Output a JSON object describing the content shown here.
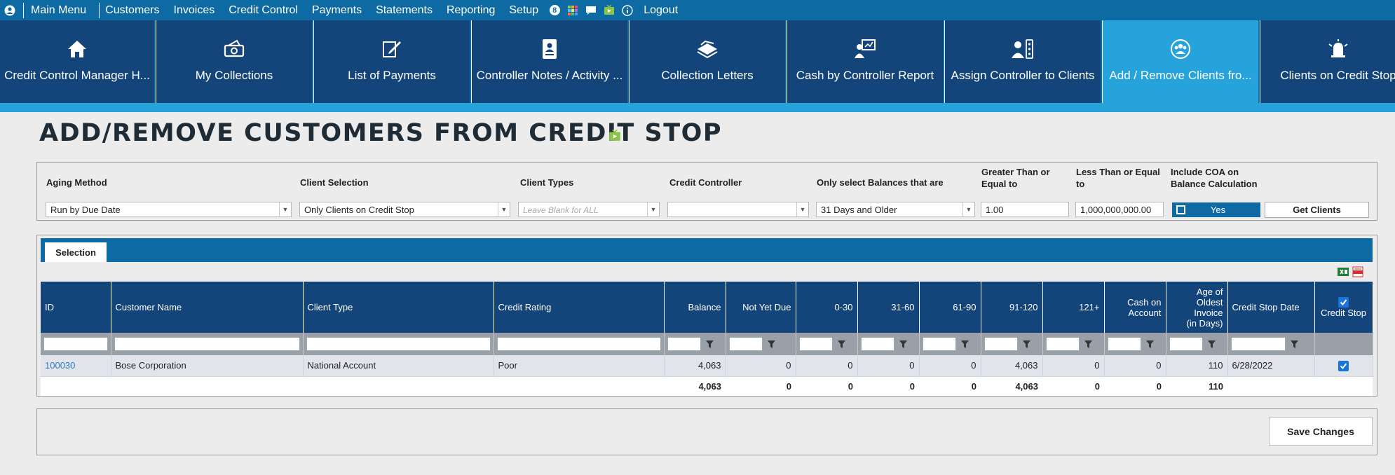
{
  "menu": {
    "items": [
      "Main Menu",
      "Customers",
      "Invoices",
      "Credit Control",
      "Payments",
      "Statements",
      "Reporting",
      "Setup"
    ],
    "badge": "8",
    "logout": "Logout"
  },
  "tiles": [
    {
      "label": "Credit Control Manager H...",
      "icon": "home-icon"
    },
    {
      "label": "My Collections",
      "icon": "money-icon"
    },
    {
      "label": "List of Payments",
      "icon": "pen-icon"
    },
    {
      "label": "Controller Notes / Activity ...",
      "icon": "notebook-icon"
    },
    {
      "label": "Collection Letters",
      "icon": "letters-icon"
    },
    {
      "label": "Cash by Controller Report",
      "icon": "presenter-icon"
    },
    {
      "label": "Assign Controller to Clients",
      "icon": "assign-icon"
    },
    {
      "label": "Add / Remove Clients fro...",
      "icon": "group-icon",
      "active": true
    },
    {
      "label": "Clients on Credit Stop",
      "icon": "alarm-icon"
    }
  ],
  "page": {
    "title": "ADD/REMOVE CUSTOMERS FROM CREDIT STOP"
  },
  "filters": {
    "aging_method": {
      "label": "Aging Method",
      "value": "Run by Due Date"
    },
    "client_selection": {
      "label": "Client Selection",
      "value": "Only Clients on Credit Stop"
    },
    "client_types": {
      "label": "Client Types",
      "placeholder": "Leave Blank for ALL"
    },
    "credit_controller": {
      "label": "Credit Controller",
      "value": ""
    },
    "balances": {
      "label": "Only select Balances that are",
      "value": "31 Days and Older"
    },
    "greater_than": {
      "label_1": "Greater Than or",
      "label_2": "Equal to",
      "value": "1.00"
    },
    "less_than": {
      "label_1": "Less Than or Equal",
      "label_2": "to",
      "value": "1,000,000,000.00"
    },
    "include_coa": {
      "label_1": "Include COA on",
      "label_2": "Balance Calculation",
      "value": "Yes"
    },
    "get_clients": "Get Clients"
  },
  "grid": {
    "tab": "Selection",
    "headers": {
      "id": "ID",
      "name": "Customer Name",
      "type": "Client Type",
      "rating": "Credit Rating",
      "balance": "Balance",
      "nyd": "Not Yet Due",
      "b0_30": "0-30",
      "b31_60": "31-60",
      "b61_90": "61-90",
      "b91_120": "91-120",
      "b121": "121+",
      "coa_1": "Cash on",
      "coa_2": "Account",
      "age_1": "Age of",
      "age_2": "Oldest",
      "age_3": "Invoice",
      "age_4": "(in Days)",
      "stop_date": "Credit Stop Date",
      "stop": "Credit Stop"
    },
    "row": {
      "id": "100030",
      "name": "Bose Corporation",
      "type": "National Account",
      "rating": "Poor",
      "balance": "4,063",
      "nyd": "0",
      "b0_30": "0",
      "b31_60": "0",
      "b61_90": "0",
      "b91_120": "4,063",
      "b121": "0",
      "coa": "0",
      "age": "110",
      "stop_date": "6/28/2022",
      "stop": true
    },
    "totals": {
      "balance": "4,063",
      "nyd": "0",
      "b0_30": "0",
      "b31_60": "0",
      "b61_90": "0",
      "b91_120": "4,063",
      "b121": "0",
      "coa": "0",
      "age": "110"
    }
  },
  "footer": {
    "save": "Save Changes"
  },
  "colors": {
    "menu_bg": "#0d6aa3",
    "tile_bg": "#14457a",
    "tile_active": "#27a3dc",
    "link": "#2c7cc0"
  }
}
